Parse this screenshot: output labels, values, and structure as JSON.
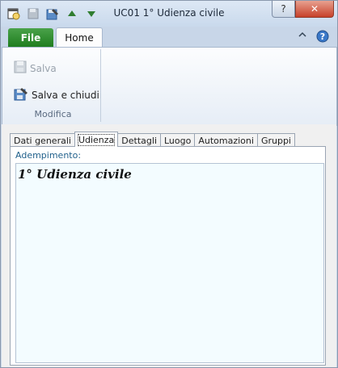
{
  "window": {
    "title": "UC01 1° Udienza civile"
  },
  "quick_access": [
    {
      "icon": "appointment-icon"
    },
    {
      "icon": "save-icon"
    },
    {
      "icon": "save-close-icon"
    },
    {
      "icon": "arrow-up-icon"
    },
    {
      "icon": "arrow-down-icon"
    }
  ],
  "controls": {
    "help": "?",
    "close": "✕"
  },
  "ribbon": {
    "file_tab": "File",
    "home_tab": "Home",
    "save_label": "Salva",
    "save_close_label": "Salva e chiudi",
    "group_label": "Modifica"
  },
  "tabs": [
    "Dati generali",
    "Udienza",
    "Dettagli",
    "Luogo",
    "Automazioni",
    "Gruppi"
  ],
  "active_tab": "Udienza",
  "form": {
    "label": "Adempimento:",
    "value": "1° Udienza civile"
  }
}
